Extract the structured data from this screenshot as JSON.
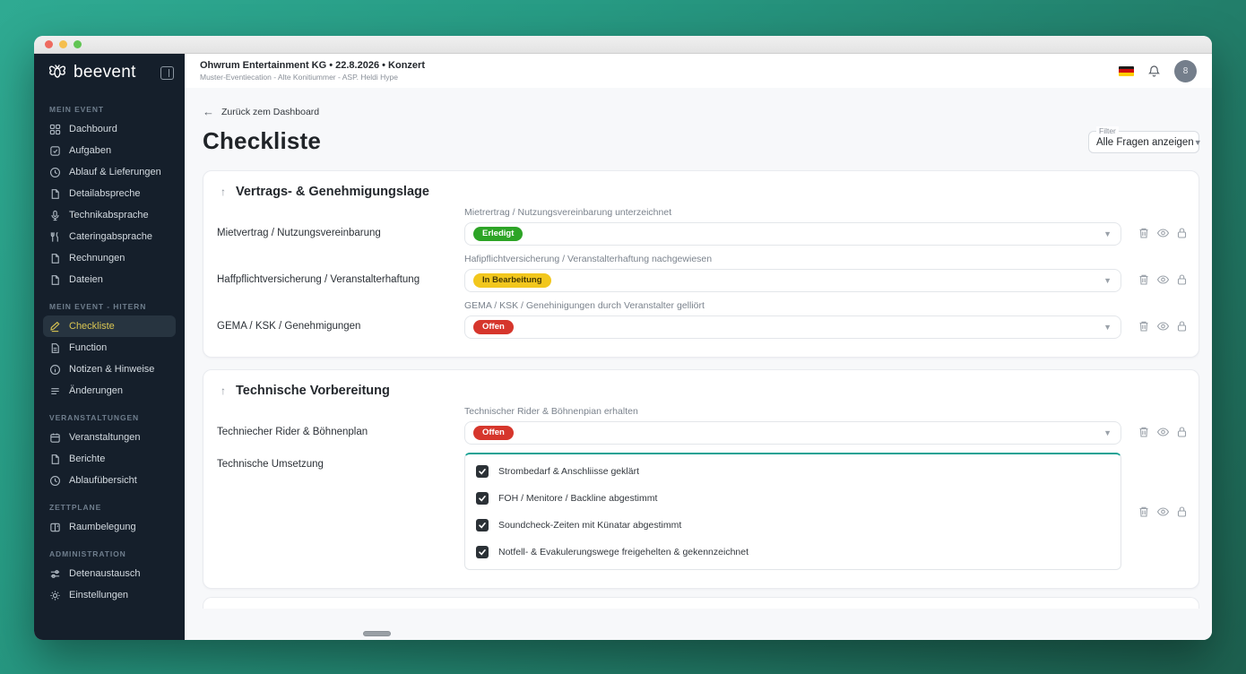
{
  "colors": {
    "background_gradient": [
      "#2faa92",
      "#1d604f"
    ],
    "sidebar_bg": "#151f2b",
    "active_item_text": "#d9c552",
    "accent_teal": "#17a294",
    "status_done": "#2da426",
    "status_in_progress": "#f2c71d",
    "status_open": "#d6362c"
  },
  "sidebar": {
    "logo_text": "beevent",
    "sections": [
      {
        "label": "MEIN EVENT",
        "items": [
          {
            "icon": "dashboard-icon",
            "label": "Dachbourd"
          },
          {
            "icon": "tasks-icon",
            "label": "Aufgaben"
          },
          {
            "icon": "clock-icon",
            "label": "Ablauf & Lieferungen"
          },
          {
            "icon": "document-icon",
            "label": "Detailabspreche"
          },
          {
            "icon": "microphone-icon",
            "label": "Technikabsprache"
          },
          {
            "icon": "catering-icon",
            "label": "Cateringabsprache"
          },
          {
            "icon": "document-icon",
            "label": "Rechnungen"
          },
          {
            "icon": "document-icon",
            "label": "Dateien"
          }
        ]
      },
      {
        "label": "MEIN EVENT - HITERN",
        "items": [
          {
            "icon": "checklist-pen-icon",
            "label": "Checkliste",
            "active": true
          },
          {
            "icon": "document-icon",
            "label": "Function"
          },
          {
            "icon": "info-icon",
            "label": "Notizen & Hinweise"
          },
          {
            "icon": "list-icon",
            "label": "Änderungen"
          }
        ]
      },
      {
        "label": "VERANSTALTUNGEN",
        "items": [
          {
            "icon": "calendar-icon",
            "label": "Veranstaltungen"
          },
          {
            "icon": "document-icon",
            "label": "Berichte"
          },
          {
            "icon": "clock-icon",
            "label": "Ablaufübersicht"
          }
        ]
      },
      {
        "label": "ZETTPLANE",
        "items": [
          {
            "icon": "room-icon",
            "label": "Raumbelegung"
          }
        ]
      },
      {
        "label": "ADMINISTRATION",
        "items": [
          {
            "icon": "exchange-icon",
            "label": "Detenaustausch"
          },
          {
            "icon": "settings-icon",
            "label": "Einstellungen"
          }
        ]
      }
    ]
  },
  "header": {
    "event_title": "Ohwrum Entertainment KG • 22.8.2026 • Konzert",
    "event_subtitle": "Muster-Eventiecation - Alte Konitiummer - ASP. Heldi Hype",
    "avatar_initial": "8"
  },
  "page": {
    "back_link": "Zurück zem Dashboard",
    "title": "Checkliste",
    "filter": {
      "label": "Filter",
      "value": "Alle Fragen anzeigen"
    }
  },
  "checklist": {
    "sections": [
      {
        "title": "Vertrags- & Genehmigungslage",
        "rows": [
          {
            "label": "Mietvertrag / Nutzungsvereinbarung",
            "question": "Mietrertrag / Nutzungsvereinbarung unterzeichnet",
            "status": "Erledigt"
          },
          {
            "label": "Haffpflichtversicherung / Veranstalterhaftung",
            "question": "Hafipflichtversicherung / Veranstalterhaftung nachgewiesen",
            "status": "In Bearbeitung"
          },
          {
            "label": "GEMA / KSK / Genehmigungen",
            "question": "GEMA / KSK / Genehinigungen durch Veranstalter gelliört",
            "status": "Offen"
          }
        ]
      },
      {
        "title": "Technische Vorbereitung",
        "rows": [
          {
            "label": "Techniecher Rider & Böhnenplan",
            "question": "Technischer Rider & Böhnenpian erhalten",
            "status": "Offen"
          },
          {
            "label": "Technische Umsetzung",
            "checkboxes": [
              {
                "checked": true,
                "label": "Strombedarf & Anschliisse geklärt"
              },
              {
                "checked": true,
                "label": "FOH / Menitore / Backline abgestimmt"
              },
              {
                "checked": true,
                "label": "Soundcheck-Zeiten mit Künatar abgestimmt"
              },
              {
                "checked": true,
                "label": "Notfell- & Evakulerungswege freigehelten & gekennzeichnet"
              }
            ]
          }
        ]
      }
    ],
    "row_actions": [
      "delete",
      "view",
      "lock"
    ]
  }
}
